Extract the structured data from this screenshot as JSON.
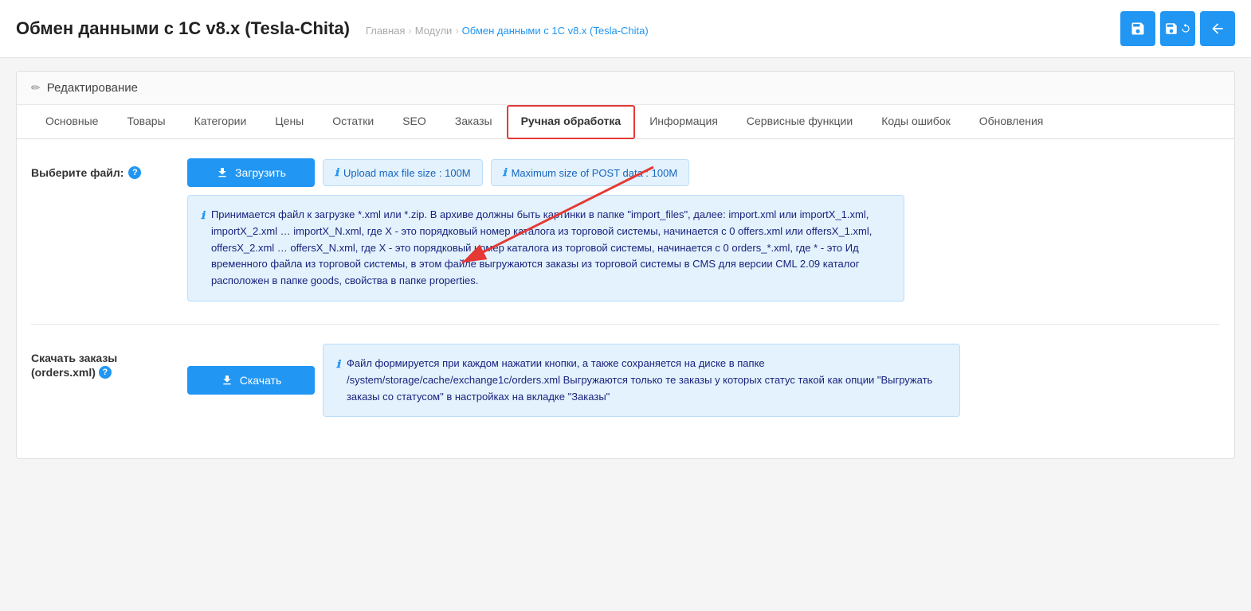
{
  "header": {
    "title": "Обмен данными с 1С v8.x (Tesla-Chita)",
    "breadcrumb": {
      "home": "Главная",
      "sep1": "›",
      "modules": "Модули",
      "sep2": "›",
      "current": "Обмен данными с 1С v8.x (Tesla-Chita)"
    },
    "actions": {
      "save_icon": "💾",
      "save_refresh_icon": "💾",
      "back_icon": "↩"
    }
  },
  "section": {
    "header_icon": "✏",
    "header_label": "Редактирование"
  },
  "tabs": [
    {
      "id": "osnovnye",
      "label": "Основные",
      "active": false,
      "highlighted": false
    },
    {
      "id": "tovary",
      "label": "Товары",
      "active": false,
      "highlighted": false
    },
    {
      "id": "kategorii",
      "label": "Категории",
      "active": false,
      "highlighted": false
    },
    {
      "id": "tseny",
      "label": "Цены",
      "active": false,
      "highlighted": false
    },
    {
      "id": "ostatki",
      "label": "Остатки",
      "active": false,
      "highlighted": false
    },
    {
      "id": "seo",
      "label": "SEO",
      "active": false,
      "highlighted": false
    },
    {
      "id": "zakazy",
      "label": "Заказы",
      "active": false,
      "highlighted": false
    },
    {
      "id": "ruchnaya",
      "label": "Ручная обработка",
      "active": true,
      "highlighted": true
    },
    {
      "id": "informatsiya",
      "label": "Информация",
      "active": false,
      "highlighted": false
    },
    {
      "id": "servisnye",
      "label": "Сервисные функции",
      "active": false,
      "highlighted": false
    },
    {
      "id": "kody",
      "label": "Коды ошибок",
      "active": false,
      "highlighted": false
    },
    {
      "id": "obnovleniya",
      "label": "Обновления",
      "active": false,
      "highlighted": false
    }
  ],
  "upload_section": {
    "label": "Выберите файл:",
    "help_icon": "?",
    "upload_button": "⬇ Загрузить",
    "upload_icon": "⬇",
    "upload_label": "Загрузить",
    "badge1_icon": "ℹ",
    "badge1_text": "Upload max file size : 100M",
    "badge2_icon": "ℹ",
    "badge2_text": "Maximum size of POST data : 100M",
    "info_icon": "ℹ",
    "info_text": "Принимается файл к загрузке *.xml или *.zip. В архиве должны быть картинки в папке \"import_files\", далее: import.xml или importX_1.xml, importX_2.xml … importX_N.xml, где X - это порядковый номер каталога из торговой системы, начинается с 0 offers.xml или offersX_1.xml, offersX_2.xml … offersX_N.xml, где X - это порядковый номер каталога из торговой системы, начинается с 0 orders_*.xml, где * - это Ид временного файла из торговой системы, в этом файле выгружаются заказы из торговой системы в CMS для версии CML 2.09 каталог расположен в папке goods, свойства в папке properties."
  },
  "download_section": {
    "label": "Скачать заказы",
    "label2": "(orders.xml)",
    "help_icon": "?",
    "download_button": "⬇ Скачать",
    "download_icon": "⬇",
    "download_label": "Скачать",
    "info_icon": "ℹ",
    "info_text": "Файл формируется при каждом нажатии кнопки, а также сохраняется на диске в папке /system/storage/cache/exchange1c/orders.xml Выгружаются только те заказы у которых статус такой как опции \"Выгружать заказы со статусом\" в настройках на вкладке \"Заказы\""
  }
}
